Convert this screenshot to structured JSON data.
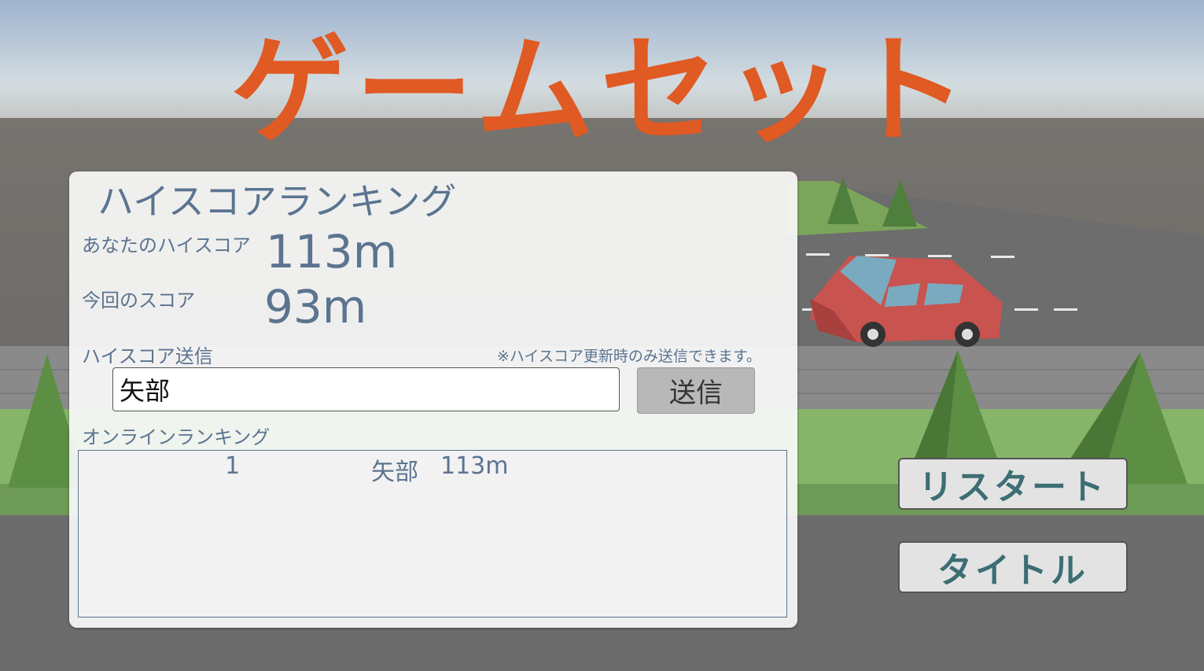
{
  "game": {
    "title": "ゲームセット"
  },
  "ranking_panel": {
    "heading": "ハイスコアランキング",
    "high_score_label": "あなたのハイスコア",
    "high_score_value": "113m",
    "current_score_label": "今回のスコア",
    "current_score_value": "93m",
    "submit_label": "ハイスコア送信",
    "submit_note": "※ハイスコア更新時のみ送信できます。",
    "name_input_value": "矢部",
    "send_button": "送信",
    "online_label": "オンラインランキング",
    "online_rows": [
      {
        "rank": "1",
        "name": "矢部",
        "score": "113m"
      }
    ]
  },
  "buttons": {
    "restart": "リスタート",
    "title": "タイトル"
  },
  "colors": {
    "title": "#e05a23",
    "panel_text": "#5b7490",
    "button_text": "#3c6e74"
  }
}
